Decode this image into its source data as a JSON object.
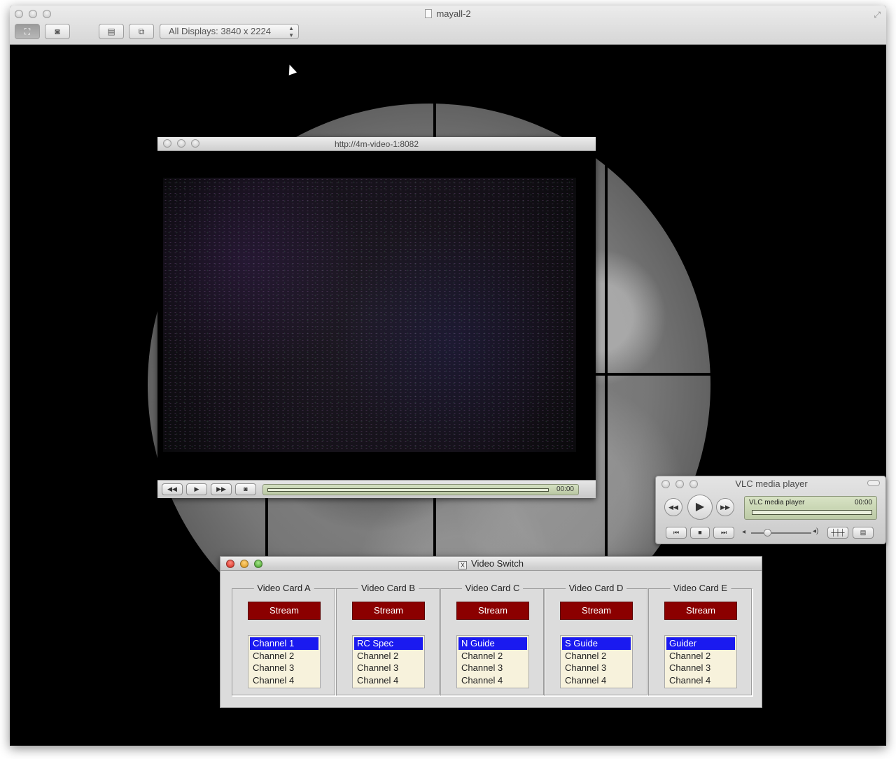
{
  "main_window": {
    "title": "mayall-2",
    "display_select": "All Displays: 3840 x 2224"
  },
  "video_window": {
    "title": "http://4m-video-1:8082",
    "time": "00:00"
  },
  "vlc": {
    "title": "VLC media player",
    "lcd_name": "VLC media player",
    "time": "00:00"
  },
  "video_switch": {
    "title": "Video Switch",
    "cards": [
      {
        "label": "Video Card A",
        "stream": "Stream",
        "channels": [
          "Channel 1",
          "Channel 2",
          "Channel 3",
          "Channel 4"
        ],
        "selected_index": 0
      },
      {
        "label": "Video Card B",
        "stream": "Stream",
        "channels": [
          "RC Spec",
          "Channel 2",
          "Channel 3",
          "Channel 4"
        ],
        "selected_index": 0
      },
      {
        "label": "Video Card C",
        "stream": "Stream",
        "channels": [
          "N Guide",
          "Channel 2",
          "Channel 3",
          "Channel 4"
        ],
        "selected_index": 0
      },
      {
        "label": "Video Card D",
        "stream": "Stream",
        "channels": [
          "S Guide",
          "Channel 2",
          "Channel 3",
          "Channel 4"
        ],
        "selected_index": 0
      },
      {
        "label": "Video Card E",
        "stream": "Stream",
        "channels": [
          "Guider",
          "Channel 2",
          "Channel 3",
          "Channel 4"
        ],
        "selected_index": 0
      }
    ]
  },
  "colors": {
    "stream_button": "#8b0000",
    "selection": "#1a1af0",
    "listbox_bg": "#f7f2dc",
    "lcd": "#c8d4b2"
  },
  "icons": [
    "doc-icon",
    "fullscreen-icon",
    "fit-screen-icon",
    "camera-icon",
    "clipboard-icon",
    "share-icon",
    "rewind-icon",
    "play-icon",
    "fast-forward-icon",
    "fullscreen-video-icon",
    "prev-icon",
    "stop-icon",
    "next-icon",
    "volume-low-icon",
    "volume-high-icon",
    "equalizer-icon",
    "playlist-icon",
    "x11-icon"
  ]
}
